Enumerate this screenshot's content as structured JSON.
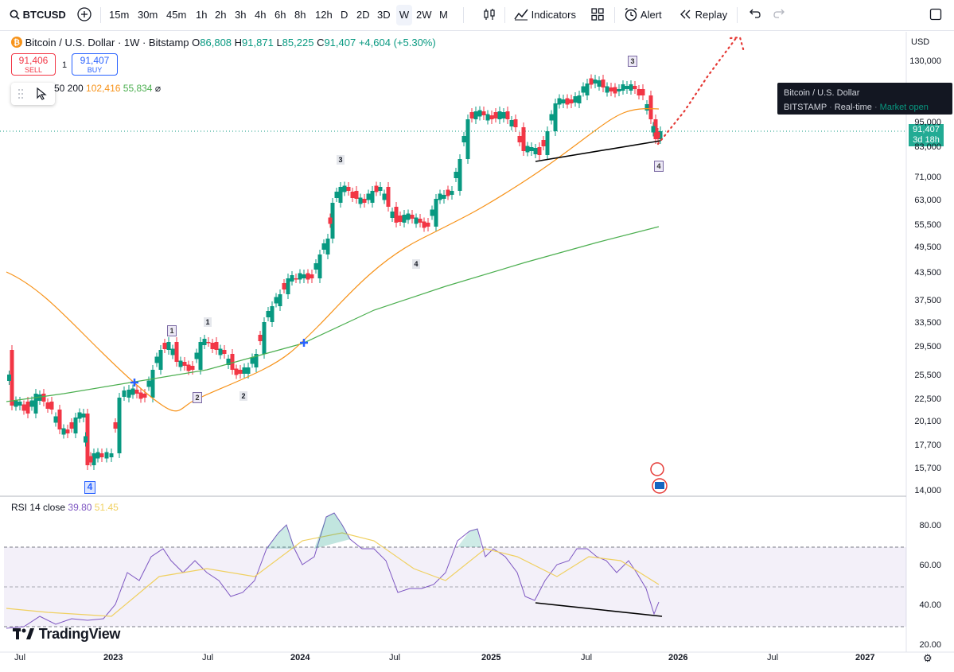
{
  "toolbar": {
    "symbol": "BTCUSD",
    "intervals": [
      "15m",
      "30m",
      "45m",
      "1h",
      "2h",
      "3h",
      "4h",
      "6h",
      "8h",
      "12h",
      "D",
      "2D",
      "3D",
      "W",
      "2W",
      "M"
    ],
    "active_interval": "W",
    "indicators_label": "Indicators",
    "alert_label": "Alert",
    "replay_label": "Replay"
  },
  "legend": {
    "title": "Bitcoin / U.S. Dollar · 1W · Bitstamp",
    "open_label": "O",
    "open": "86,808",
    "high_label": "H",
    "high": "91,871",
    "low_label": "L",
    "low": "85,225",
    "close_label": "C",
    "close": "91,407",
    "change": "+4,604 (+5.30%)"
  },
  "trade": {
    "sell_price": "91,406",
    "sell_label": "SELL",
    "spread": "1",
    "buy_price": "91,407",
    "buy_label": "BUY"
  },
  "ma_legend": {
    "label": "50 200",
    "ma50": "102,416",
    "ma200": "55,834",
    "ma50_color": "#f7931a",
    "ma200_color": "#4caf50"
  },
  "price_axis": {
    "currency": "USD",
    "ticks": [
      "130,000",
      "95,000",
      "83,000",
      "71,000",
      "63,000",
      "55,500",
      "49,500",
      "43,500",
      "37,500",
      "33,500",
      "29,500",
      "25,500",
      "22,500",
      "20,100",
      "17,700",
      "15,700",
      "14,000"
    ]
  },
  "current_price": {
    "value": "91,407",
    "countdown": "3d 18h"
  },
  "tooltip": {
    "line1": "Bitcoin / U.S. Dollar",
    "exchange": "BITSTAMP",
    "realtime": "Real-time",
    "status": "Market open"
  },
  "rsi": {
    "label": "RSI 14 close",
    "value": "39.80",
    "ma_value": "51.45",
    "ticks": [
      "80.00",
      "60.00",
      "40.00",
      "20.00"
    ],
    "line_color": "#7e57c2",
    "ma_color": "#f0d060"
  },
  "x_axis": {
    "labels": [
      "Jul",
      "2023",
      "Jul",
      "2024",
      "Jul",
      "2025",
      "Jul",
      "2026",
      "Jul",
      "2027"
    ]
  },
  "waves": [
    "1",
    "2",
    "1",
    "2",
    "3",
    "4",
    "3",
    "4",
    "4"
  ],
  "brand": "TradingView",
  "colors": {
    "up": "#089981",
    "down": "#f23645",
    "accent": "#2962ff"
  }
}
